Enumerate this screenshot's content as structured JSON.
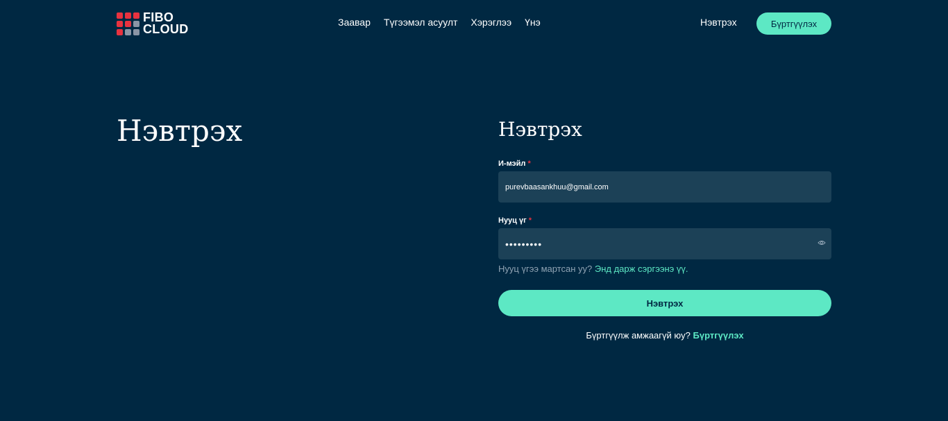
{
  "brand": {
    "line1": "FIBO",
    "line2": "CLOUD"
  },
  "nav": {
    "items": [
      {
        "label": "Заавар"
      },
      {
        "label": "Түгээмэл асуулт"
      },
      {
        "label": "Хэрэглээ"
      },
      {
        "label": "Үнэ"
      }
    ],
    "login_label": "Нэвтрэх",
    "register_label": "Бүртгүүлэх"
  },
  "page": {
    "title": "Нэвтрэх"
  },
  "form": {
    "title": "Нэвтрэх",
    "email": {
      "label": "И-мэйл",
      "required_mark": "*",
      "value": "purevbaasankhuu@gmail.com"
    },
    "password": {
      "label": "Нууц үг",
      "required_mark": "*",
      "value": "•••••••••"
    },
    "forgot_text": "Нууц үгээ мартсан уу?",
    "forgot_link": "Энд дарж сэргээнэ үү.",
    "submit_label": "Нэвтрэх",
    "signup_text": "Бүртгүүлж амжаагүй юу?",
    "signup_link": "Бүртгүүлэх"
  },
  "colors": {
    "background": "#002842",
    "accent": "#5de8c4",
    "input_bg": "#1c4157",
    "logo_red": "#e8323f"
  }
}
